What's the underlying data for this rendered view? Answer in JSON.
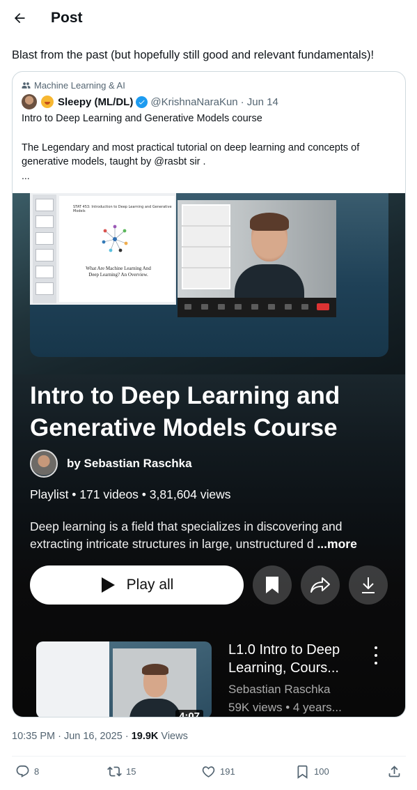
{
  "header": {
    "title": "Post"
  },
  "tweet": {
    "text": "Blast from the past (but hopefully still good and relevant fundamentals)!"
  },
  "quote": {
    "community": "Machine Learning & AI",
    "author_name": "Sleepy (ML/DL)",
    "author_handle": "@KrishnaNaraKun",
    "date": "· Jun 14",
    "line1": "Intro to Deep Learning and Generative Models course",
    "line2": "The Legendary and most practical tutorial on deep learning and concepts of generative models, taught by @rasbt sir .",
    "ellipsis": "..."
  },
  "youtube": {
    "slide_title": "STAT 453: Introduction to Deep Learning and Generative Models",
    "slide_caption": "What Are Machine Learning And Deep Learning? An Overview.",
    "title": "Intro to Deep Learning and Generative Models Course",
    "channel": "by Sebastian Raschka",
    "meta": "Playlist • 171 videos • 3,81,604 views",
    "description": "Deep learning is a field that specializes in discovering and extracting intricate structures in large, unstructured d",
    "more": "...more",
    "play_all": "Play all",
    "next": {
      "title": "L1.0 Intro to Deep Learning, Cours...",
      "channel": "Sebastian Raschka",
      "stats": "59K views • 4 years...",
      "duration": "4:07"
    }
  },
  "meta": {
    "time": "10:35 PM · Jun 16, 2025 · ",
    "views_count": "19.9K",
    "views_label": " Views"
  },
  "actions": {
    "replies": "8",
    "reposts": "15",
    "likes": "191",
    "bookmarks": "100"
  },
  "colors": {
    "text": "#0f1419",
    "secondary": "#536471",
    "verified": "#1d9bf0",
    "border": "#cfd9de"
  }
}
